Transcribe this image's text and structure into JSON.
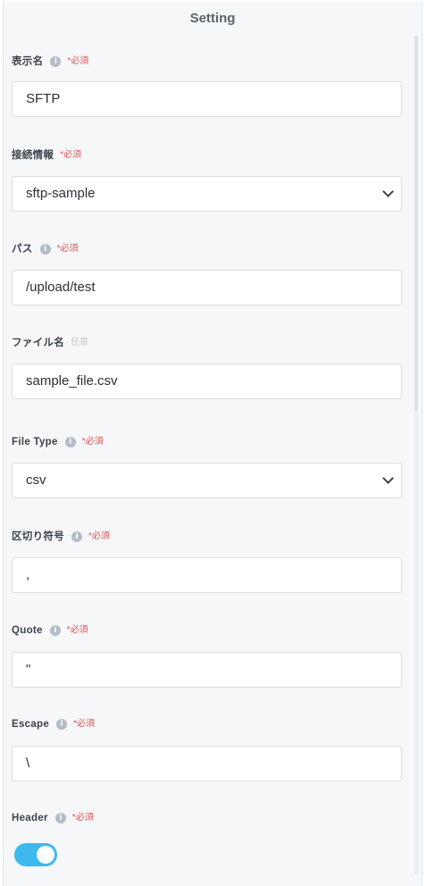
{
  "panel": {
    "title": "Setting"
  },
  "required_tag": "*必須",
  "optional_tag": "任意",
  "fields": {
    "display_name": {
      "label": "表示名",
      "value": "SFTP"
    },
    "connection": {
      "label": "接続情報",
      "value": "sftp-sample"
    },
    "path": {
      "label": "パス",
      "value": "/upload/test"
    },
    "file_name": {
      "label": "ファイル名",
      "value": "sample_file.csv"
    },
    "file_type": {
      "label": "File Type",
      "value": "csv"
    },
    "delimiter": {
      "label": "区切り符号",
      "value": ","
    },
    "quote": {
      "label": "Quote",
      "value": "\""
    },
    "escape": {
      "label": "Escape",
      "value": "\\"
    },
    "header": {
      "label": "Header",
      "enabled": true
    }
  },
  "colors": {
    "toggle_on": "#3fb8f0",
    "required": "#e2534f"
  }
}
